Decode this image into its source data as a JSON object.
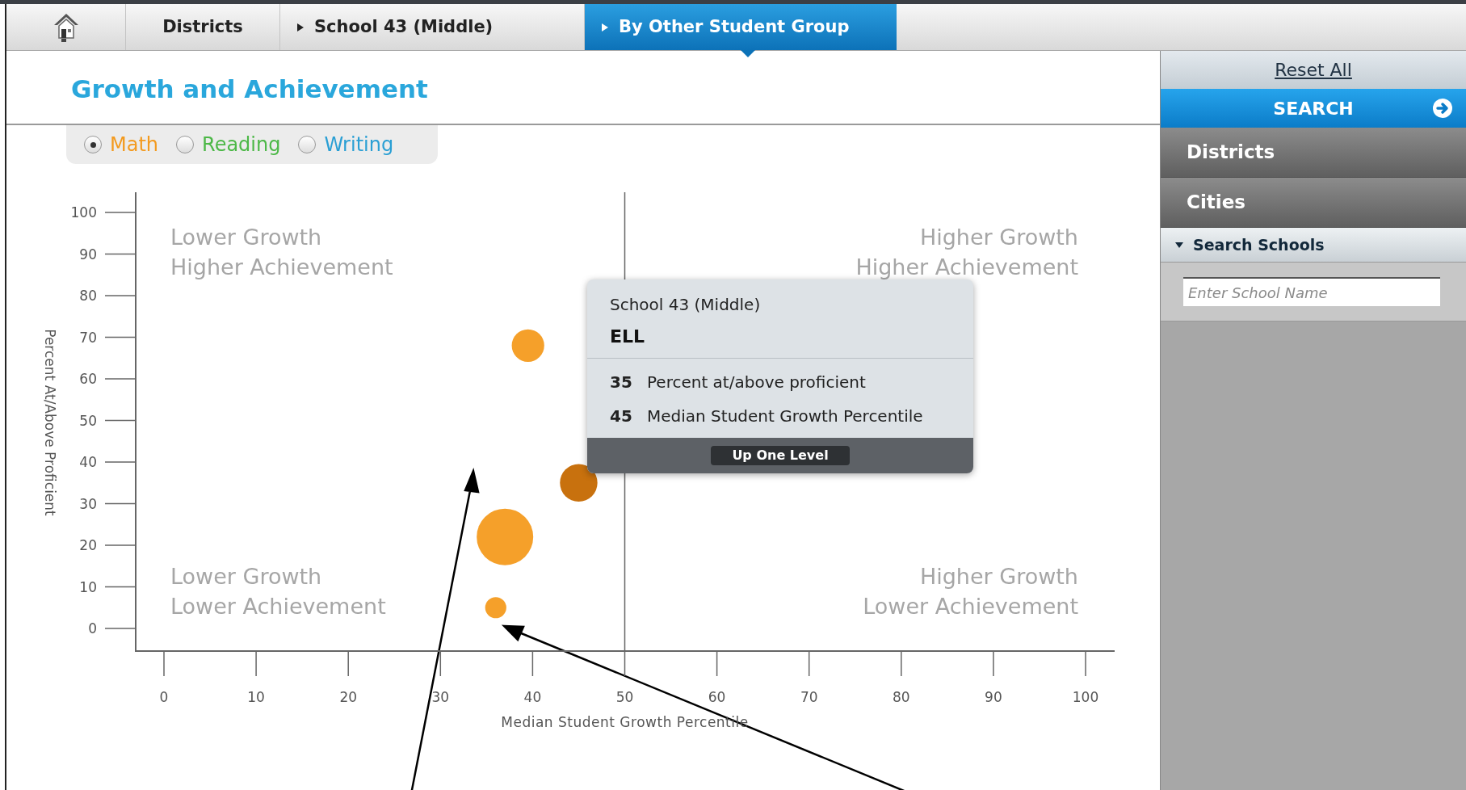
{
  "breadcrumb": [
    {
      "label": "Districts",
      "caret": false,
      "selected": false
    },
    {
      "label": "School 43 (Middle)",
      "caret": true,
      "selected": false
    },
    {
      "label": "By Other Student Group",
      "caret": true,
      "selected": true
    }
  ],
  "title": "Growth and Achievement",
  "subjects": [
    {
      "label": "Math",
      "color": "#f39a1e",
      "selected": true
    },
    {
      "label": "Reading",
      "color": "#4cb847",
      "selected": false
    },
    {
      "label": "Writing",
      "color": "#2a9fd4",
      "selected": false
    }
  ],
  "chart": {
    "quadrant_labels": [
      {
        "kind": "top-left",
        "lines": [
          "Lower Growth",
          "Higher Achievement"
        ]
      },
      {
        "kind": "top-right",
        "lines": [
          "Higher Growth",
          "Higher Achievement"
        ]
      },
      {
        "kind": "bottom-left",
        "lines": [
          "Lower Growth",
          "Lower Achievement"
        ]
      },
      {
        "kind": "bottom-right",
        "lines": [
          "Higher Growth",
          "Lower Achievement"
        ]
      }
    ],
    "chart_data": {
      "type": "scatter",
      "xlabel": "Median Student Growth Percentile",
      "ylabel": "Percent At/Above Proficient",
      "x": [
        36,
        37,
        39.5,
        45
      ],
      "series": [
        {
          "color": "#f5a02a",
          "values": [
            5,
            22,
            68,
            null
          ],
          "sizes": [
            0.14,
            1,
            0.33,
            null
          ]
        },
        {
          "color": "#c8710e",
          "values": [
            null,
            null,
            null,
            35
          ],
          "sizes": [
            null,
            null,
            null,
            0.44
          ]
        }
      ],
      "xlim": [
        0,
        100
      ],
      "ylim": [
        0,
        100
      ],
      "xticks": [
        0,
        10,
        20,
        30,
        40,
        50,
        60,
        70,
        80,
        90,
        100
      ],
      "yticks": [
        0,
        10,
        20,
        30,
        40,
        50,
        60,
        70,
        80,
        90,
        100
      ]
    }
  },
  "tooltip": {
    "school": "School 43 (Middle)",
    "group": "ELL",
    "rows": [
      {
        "value": "35",
        "label": "Percent at/above proficient"
      },
      {
        "value": "45",
        "label": "Median Student Growth Percentile"
      }
    ],
    "button": "Up One Level"
  },
  "sidebar": {
    "reset": "Reset All",
    "search": "SEARCH",
    "sections": [
      {
        "label": "Districts",
        "expanded": false
      },
      {
        "label": "Cities",
        "expanded": false
      },
      {
        "label": "Search Schools",
        "expanded": true,
        "placeholder": "Enter School Name"
      }
    ]
  }
}
